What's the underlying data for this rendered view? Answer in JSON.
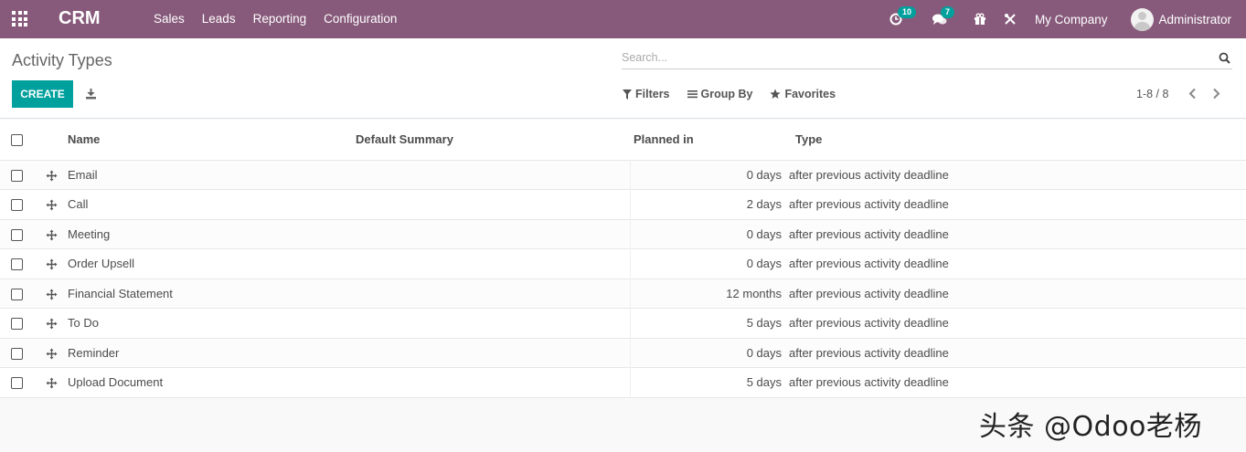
{
  "navbar": {
    "brand": "CRM",
    "menu": [
      "Sales",
      "Leads",
      "Reporting",
      "Configuration"
    ],
    "activity_count": "10",
    "message_count": "7",
    "company": "My Company",
    "user": "Administrator",
    "icons": [
      "apps-grid-icon",
      "clock-icon",
      "chat-icon",
      "gift-icon",
      "tools-icon",
      "avatar"
    ]
  },
  "control_panel": {
    "title": "Activity Types",
    "search_placeholder": "Search...",
    "create_label": "CREATE",
    "filters_label": "Filters",
    "groupby_label": "Group By",
    "favorites_label": "Favorites",
    "pager": "1-8 / 8"
  },
  "table": {
    "columns": [
      "Name",
      "Default Summary",
      "Planned in",
      "Type"
    ],
    "rows": [
      {
        "name": "Email",
        "summary": "",
        "planned": "0 days",
        "type": "after previous activity deadline"
      },
      {
        "name": "Call",
        "summary": "",
        "planned": "2 days",
        "type": "after previous activity deadline"
      },
      {
        "name": "Meeting",
        "summary": "",
        "planned": "0 days",
        "type": "after previous activity deadline"
      },
      {
        "name": "Order Upsell",
        "summary": "",
        "planned": "0 days",
        "type": "after previous activity deadline"
      },
      {
        "name": "Financial Statement",
        "summary": "",
        "planned": "12 months",
        "type": "after previous activity deadline"
      },
      {
        "name": "To Do",
        "summary": "",
        "planned": "5 days",
        "type": "after previous activity deadline"
      },
      {
        "name": "Reminder",
        "summary": "",
        "planned": "0 days",
        "type": "after previous activity deadline"
      },
      {
        "name": "Upload Document",
        "summary": "",
        "planned": "5 days",
        "type": "after previous activity deadline"
      }
    ]
  },
  "watermark": "头条 @Odoo老杨",
  "colors": {
    "navbar": "#875a7b",
    "accent": "#00a09d"
  }
}
